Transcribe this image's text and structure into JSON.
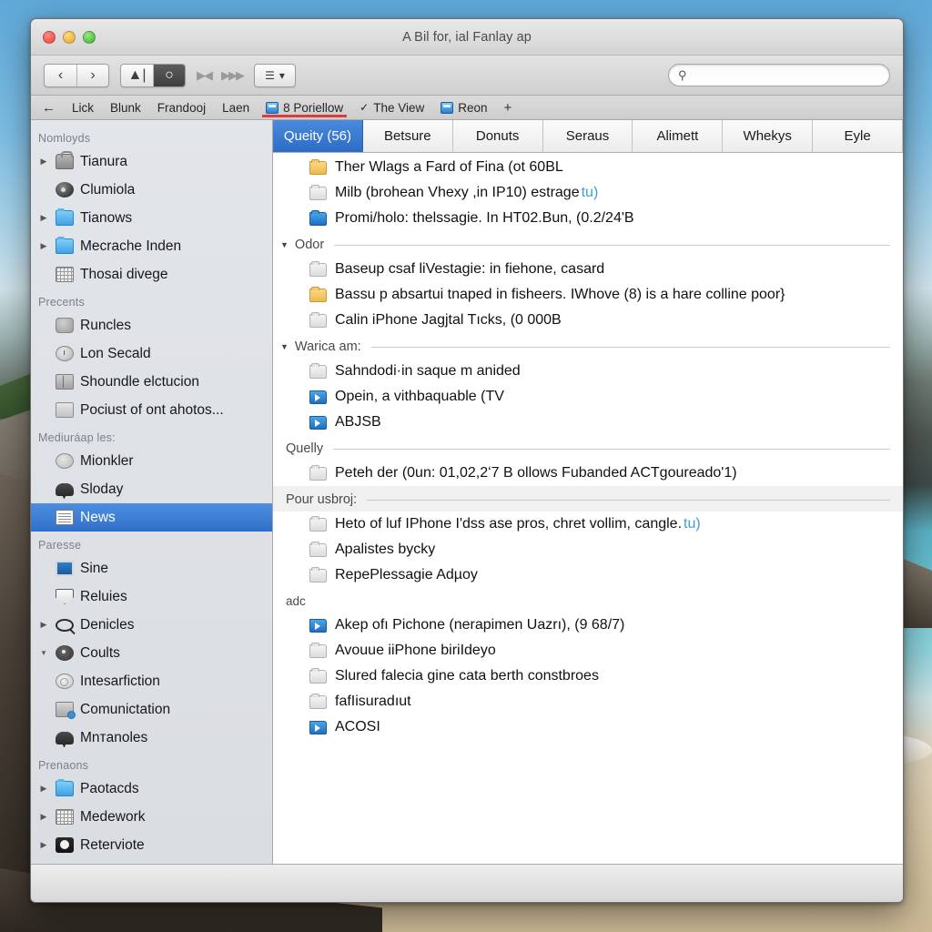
{
  "window": {
    "title": "A Bil for, ial Fanlay ap"
  },
  "toolbar": {
    "back_icon": "chevron-left-icon",
    "forward_icon": "chevron-right-icon",
    "reader_icon": "reader-icon",
    "reload_icon": "reload-icon",
    "play_prev_icon": "play-prev-icon",
    "play_next_icon": "play-next-icon",
    "view_icon": "list-view-icon",
    "view_caret": "▾",
    "search_icon": "search-icon",
    "search_value": "",
    "search_placeholder": ""
  },
  "bookmarks": {
    "back_arrow": "←",
    "items": [
      {
        "label": "Lick",
        "icon": "",
        "active": false
      },
      {
        "label": "Blunk",
        "icon": "",
        "active": false
      },
      {
        "label": "Frandooj",
        "icon": "",
        "active": false
      },
      {
        "label": "Laen",
        "icon": "",
        "active": false
      },
      {
        "label": "8 Poriellow",
        "icon": "page-favicon",
        "active": true
      },
      {
        "label": "The View",
        "icon": "check-icon",
        "active": false
      },
      {
        "label": "Reon",
        "icon": "page-favicon",
        "active": false
      }
    ],
    "add_label": "+"
  },
  "sidebar": {
    "groups": [
      {
        "title": "Nomloyds",
        "items": [
          {
            "label": "Tianura",
            "icon": "bag-icon",
            "disclosure": "▶",
            "selected": false
          },
          {
            "label": "Clumiola",
            "icon": "disc-icon",
            "disclosure": "",
            "selected": false
          },
          {
            "label": "Tianows",
            "icon": "folder-icon",
            "disclosure": "▶",
            "selected": false
          },
          {
            "label": "Mecrache Inden",
            "icon": "folder-icon",
            "disclosure": "▶",
            "selected": false
          },
          {
            "label": "Thosai divege",
            "icon": "grid-icon",
            "disclosure": "",
            "selected": false
          }
        ]
      },
      {
        "title": "Precents",
        "items": [
          {
            "label": "Runcles",
            "icon": "bulb-icon",
            "disclosure": "",
            "selected": false
          },
          {
            "label": "Lon Secald",
            "icon": "clock-icon",
            "disclosure": "",
            "selected": false
          },
          {
            "label": "Shoundle elctucion",
            "icon": "book-icon",
            "disclosure": "",
            "selected": false
          },
          {
            "label": "Pociust of ont ahotos...",
            "icon": "blank-icon",
            "disclosure": "",
            "selected": false
          }
        ]
      },
      {
        "title": "Mediuráap les:",
        "items": [
          {
            "label": "Mionkler",
            "icon": "at-icon",
            "disclosure": "",
            "selected": false
          },
          {
            "label": "Sloday",
            "icon": "cloud-icon",
            "disclosure": "",
            "selected": false
          },
          {
            "label": "News",
            "icon": "news-icon",
            "disclosure": "",
            "selected": true
          }
        ]
      },
      {
        "title": "Paresse",
        "items": [
          {
            "label": "Sine",
            "icon": "screen-icon",
            "disclosure": "",
            "selected": false
          },
          {
            "label": "Reluies",
            "icon": "shield-icon",
            "disclosure": "",
            "selected": false
          },
          {
            "label": "Denicles",
            "icon": "search-icon",
            "disclosure": "▶",
            "selected": false
          },
          {
            "label": "Coults",
            "icon": "dark-icon",
            "disclosure": "▾",
            "selected": false
          },
          {
            "label": "Intesarfiction",
            "icon": "ring-icon",
            "disclosure": "",
            "selected": false
          },
          {
            "label": "Comunictation",
            "icon": "device-icon",
            "disclosure": "",
            "selected": false
          },
          {
            "label": "Mnᴛanoles",
            "icon": "cloud-icon",
            "disclosure": "",
            "selected": false
          }
        ]
      },
      {
        "title": "Prenaons",
        "items": [
          {
            "label": "Paotacds",
            "icon": "folder-icon",
            "disclosure": "▶",
            "selected": false
          },
          {
            "label": "Medework",
            "icon": "grid-icon",
            "disclosure": "▶",
            "selected": false
          },
          {
            "label": "Reterviote",
            "icon": "camera-icon",
            "disclosure": "▶",
            "selected": false
          }
        ]
      }
    ]
  },
  "tabs": [
    {
      "label": "Queity (56)",
      "active": true
    },
    {
      "label": "Betsure",
      "active": false
    },
    {
      "label": "Donuts",
      "active": false
    },
    {
      "label": "Seraus",
      "active": false
    },
    {
      "label": "Alimett",
      "active": false
    },
    {
      "label": "Whekys",
      "active": false
    },
    {
      "label": "Eyle",
      "active": false
    }
  ],
  "sections": [
    {
      "header": null,
      "rows": [
        {
          "icon": "folder-yellow-icon",
          "text": "Ther Wlags a Fard of Fina (ot 60BL",
          "link_tail": ""
        },
        {
          "icon": "folder-grey-icon",
          "text": "Milb (brohean Vhexy ,in IP10) estrage ",
          "link_tail": "tu)"
        },
        {
          "icon": "folder-blue-icon",
          "text": "Promi/holo: thelssagie. In HT02.Bun, (0.2/24'B",
          "link_tail": ""
        }
      ]
    },
    {
      "header": {
        "label": "Odor",
        "style": "disclosure"
      },
      "rows": [
        {
          "icon": "folder-grey-icon",
          "text": "Baseup csaf liVestagie: in fiehone, casard",
          "link_tail": ""
        },
        {
          "icon": "folder-yellow-icon",
          "text": "Bassu p absartui tnaped in fisheers. IWhove (8) is a hare colline poor}",
          "link_tail": ""
        },
        {
          "icon": "folder-grey-icon",
          "text": "Calin iPhone Jagjtal Tıcks, (0 000B",
          "link_tail": ""
        }
      ]
    },
    {
      "header": {
        "label": "Warica am:",
        "style": "disclosure"
      },
      "rows": [
        {
          "icon": "folder-grey-icon",
          "text": "Sahndodi·in saque m anided",
          "link_tail": ""
        },
        {
          "icon": "folder-bluearrow-icon",
          "text": "Opein, a vithbaquable (TV",
          "link_tail": ""
        },
        {
          "icon": "folder-bluearrow-icon",
          "text": "ABJSB",
          "link_tail": ""
        }
      ]
    },
    {
      "header": {
        "label": "Quelly",
        "style": "rule"
      },
      "rows": [
        {
          "icon": "folder-grey-icon",
          "text": "Peteh der (0un: 01,02,2ʻ7 B ollows Fubanded ACTgoureado'1)",
          "link_tail": ""
        }
      ]
    },
    {
      "header": {
        "label": "Pour usbroj:",
        "style": "shaded"
      },
      "rows": [
        {
          "icon": "folder-grey-icon",
          "text": "Heto of luf IPhone I'dss ase pros, chret vollim, cangle. ",
          "link_tail": "tu)"
        },
        {
          "icon": "folder-grey-icon",
          "text": "Apalistes bycky",
          "link_tail": ""
        },
        {
          "icon": "folder-grey-icon",
          "text": "RepePlessagie Adµoy",
          "link_tail": ""
        }
      ]
    },
    {
      "header": {
        "label": "adc",
        "style": "plain"
      },
      "rows": [
        {
          "icon": "folder-bluearrow-icon",
          "text": "Akep ofı Pichone (nerapimen Uazrı), (9 68/7)",
          "link_tail": ""
        },
        {
          "icon": "folder-grey-icon",
          "text": "Avouue iiPhone biriIdeyo",
          "link_tail": ""
        },
        {
          "icon": "folder-grey-icon",
          "text": "Slured falecia gine cata berth constbroes",
          "link_tail": ""
        },
        {
          "icon": "folder-grey-icon",
          "text": "fafIisuradıut",
          "link_tail": ""
        },
        {
          "icon": "folder-bluearrow-icon",
          "text": "ACOSI",
          "link_tail": ""
        }
      ]
    }
  ],
  "colors": {
    "accent_blue": "#2c6cc6",
    "selection_blue": "#2f6fc9",
    "bookmark_underline_red": "#e03a3a",
    "link_teal": "#3f9fc9"
  }
}
